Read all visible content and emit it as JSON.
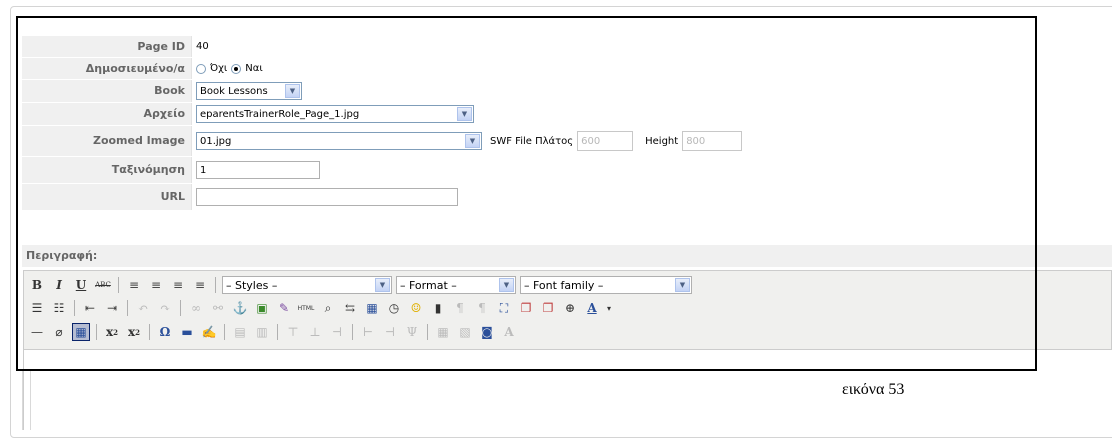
{
  "form": {
    "page_id": {
      "label": "Page ID",
      "value": "40"
    },
    "published": {
      "label": "Δημοσιευμένο/α",
      "option_no": "Όχι",
      "option_yes": "Ναι",
      "selected": "Ναι"
    },
    "book": {
      "label": "Book",
      "value": "Book Lessons"
    },
    "file": {
      "label": "Αρχείο",
      "value": "eparentsTrainerRole_Page_1.jpg"
    },
    "zoomed": {
      "label": "Zoomed Image",
      "value": "01.jpg",
      "swf_width_label": "SWF File Πλάτος",
      "swf_width_value": "600",
      "height_label": "Height",
      "height_value": "800"
    },
    "ordering": {
      "label": "Ταξινόμηση",
      "value": "1"
    },
    "url": {
      "label": "URL",
      "value": ""
    },
    "description": {
      "label": "Περιγραφή:"
    }
  },
  "toolbar": {
    "styles": "– Styles –",
    "format": "– Format –",
    "font_family": "– Font family –"
  },
  "caption": "εικόνα 53"
}
